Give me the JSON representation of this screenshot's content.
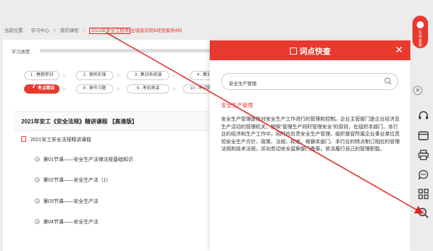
{
  "breadcrumb": {
    "prefix": "当前位置:",
    "items": [
      "学习中心",
      "我的课程"
    ],
    "current_highlight": "2021年安全工程师",
    "current_rest": "全城直训营B班他案例4科"
  },
  "progress": {
    "label": "学习进度:",
    "value": 0
  },
  "steps": [
    {
      "label": "1 . 春题密训"
    },
    {
      "label": "2 . 案例实操"
    },
    {
      "label": "3 . 集训系统课"
    },
    {
      "label": "4 . 集训"
    },
    {
      "label": "考点精讲",
      "num": "7",
      "active": true
    },
    {
      "label": "8 . 章节习题"
    },
    {
      "label": "9 . 考前串讲"
    },
    {
      "label": "10 . 考试精"
    }
  ],
  "course": {
    "title": "2021年安工《安全法规》精讲课程 【高清版】",
    "chapter": "2021安工安全法规精讲课程",
    "lessons": [
      "第01节课——安全生产法律法规基础知识",
      "第02节课——安全生产法（1）",
      "第03节课——安全生产法",
      "第04节课——安全生产法"
    ]
  },
  "panel": {
    "title": "词点快查",
    "search_value": "安全生产管理",
    "term": "安全生产管理",
    "definition": "安全生产管理是指对安全生产工作进行的管理和控制。企业主管部门是企业经济及生产活动的管理机关，按照“管理生产同时管理安全”的原则，在组织本部门、本行业的经济和生产工作中，同时也负责安全生产管理。组织督促所属企业事业单位贯彻安全生产方针、政策、法规、标准。根据本部门、本行业的特点制订相应的管理法规和技术法规，并向劳动安全监察部门备案，依法履行自己的管理职能。"
  },
  "float_button": {
    "label": "在线客服"
  },
  "rail_icons": [
    "headset-icon",
    "window-icon",
    "printer-icon",
    "chat-icon",
    "apps-icon",
    "dictionary-search-icon"
  ],
  "colors": {
    "accent": "#e8392e",
    "annotation": "#e02020"
  }
}
